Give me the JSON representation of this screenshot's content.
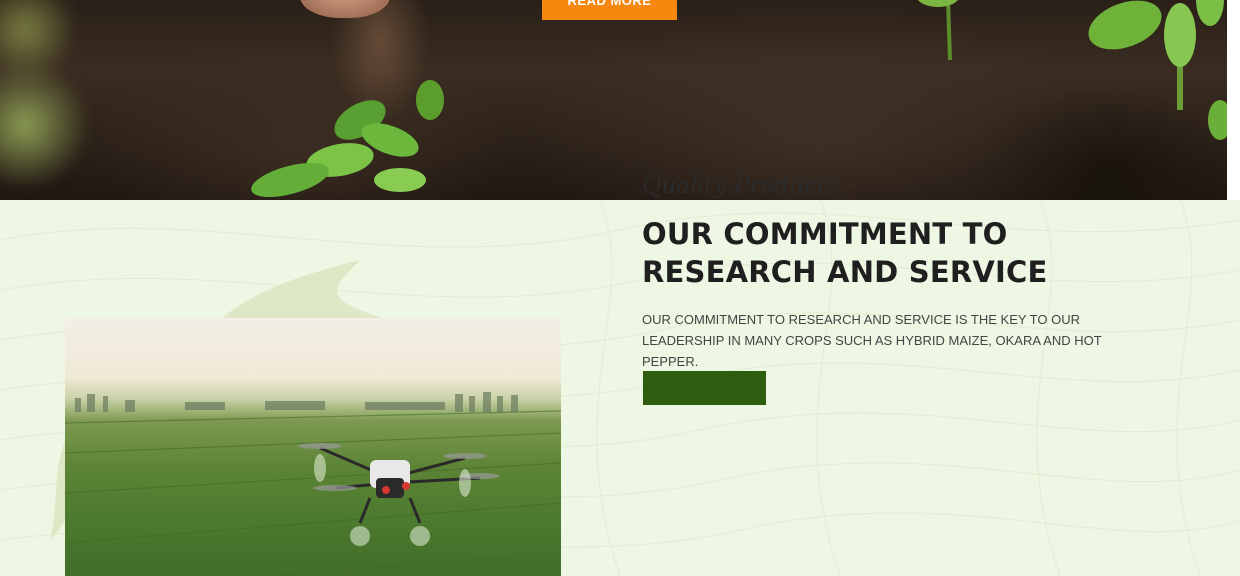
{
  "hero": {
    "read_more_label": "READ MORE"
  },
  "about": {
    "eyebrow": "Quality Products",
    "heading": "OUR COMMITMENT TO RESEARCH AND SERVICE",
    "body": "OUR COMMITMENT TO RESEARCH AND SERVICE IS THE KEY TO OUR LEADERSHIP IN MANY CROPS SUCH AS HYBRID MAIZE, OKARA AND HOT PEPPER."
  },
  "colors": {
    "accent_orange": "#f7870f",
    "accent_green": "#2f5d0f",
    "section_bg": "#eef6e4"
  },
  "images": {
    "hero_photo": "soil-seedling-photo",
    "about_photo": "crop-spraying-drone-photo"
  }
}
